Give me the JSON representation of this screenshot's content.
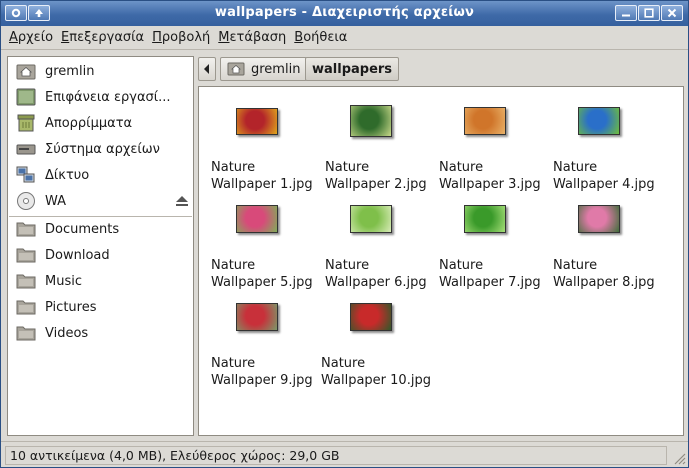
{
  "window": {
    "title": "wallpapers - Διαχειριστής αρχείων"
  },
  "menubar": [
    {
      "underline": "Α",
      "rest": "ρχείο"
    },
    {
      "underline": "Ε",
      "rest": "πεξεργασία"
    },
    {
      "underline": "Π",
      "rest": "ροβολή"
    },
    {
      "underline": "Μ",
      "rest": "ετάβαση"
    },
    {
      "underline": "Β",
      "rest": "οήθεια"
    }
  ],
  "sidebar": {
    "places": [
      {
        "label": "gremlin",
        "icon": "home-folder-icon"
      },
      {
        "label": "Επιφάνεια εργασί...",
        "icon": "desktop-icon"
      },
      {
        "label": "Απορρίμματα",
        "icon": "trash-icon"
      },
      {
        "label": "Σύστημα αρχείων",
        "icon": "filesystem-drive-icon"
      },
      {
        "label": "Δίκτυο",
        "icon": "network-icon"
      },
      {
        "label": "WA",
        "icon": "optical-disc-icon"
      }
    ],
    "bookmarks": [
      {
        "label": "Documents",
        "icon": "folder-icon"
      },
      {
        "label": "Download",
        "icon": "folder-icon"
      },
      {
        "label": "Music",
        "icon": "folder-icon"
      },
      {
        "label": "Pictures",
        "icon": "folder-icon"
      },
      {
        "label": "Videos",
        "icon": "folder-icon"
      }
    ]
  },
  "pathbar": {
    "parent": "gremlin",
    "current": "wallpapers"
  },
  "files": [
    {
      "line1": "Nature",
      "line2": "Wallpaper 1.jpg",
      "colors": [
        "#b3242a",
        "#e0a81c"
      ]
    },
    {
      "line1": "Nature",
      "line2": "Wallpaper 2.jpg",
      "colors": [
        "#2f6b2b",
        "#c9d98a"
      ]
    },
    {
      "line1": "Nature",
      "line2": "Wallpaper 3.jpg",
      "colors": [
        "#d0752a",
        "#e9b36a"
      ]
    },
    {
      "line1": "Nature",
      "line2": "Wallpaper 4.jpg",
      "colors": [
        "#2a6fc9",
        "#6fbf3a"
      ]
    },
    {
      "line1": "Nature",
      "line2": "Wallpaper 5.jpg",
      "colors": [
        "#d84a7a",
        "#7fae58"
      ]
    },
    {
      "line1": "Nature",
      "line2": "Wallpaper 6.jpg",
      "colors": [
        "#7fbf4a",
        "#d9ecb8"
      ]
    },
    {
      "line1": "Nature",
      "line2": "Wallpaper 7.jpg",
      "colors": [
        "#3a9a2a",
        "#a8e07a"
      ]
    },
    {
      "line1": "Nature",
      "line2": "Wallpaper 8.jpg",
      "colors": [
        "#e07aa8",
        "#3f6e3a"
      ]
    },
    {
      "line1": "Nature",
      "line2": "Wallpaper 9.jpg",
      "colors": [
        "#c8303a",
        "#7a9a6a"
      ]
    },
    {
      "line1": "Nature",
      "line2": "Wallpaper 10.jpg",
      "colors": [
        "#c82a2a",
        "#2f5a2a"
      ]
    }
  ],
  "statusbar": {
    "text": "10 αντικείμενα (4,0 MB), Ελεύθερος χώρος: 29,0 GB"
  }
}
